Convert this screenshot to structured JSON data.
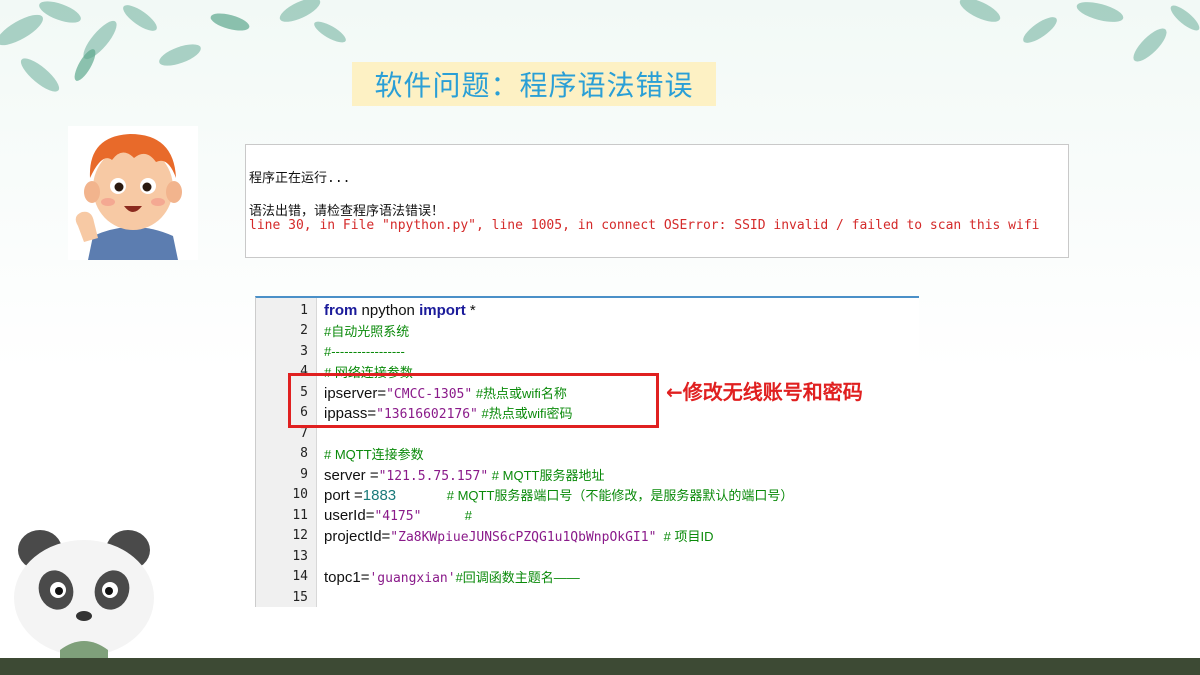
{
  "title": "软件问题：程序语法错误",
  "console": {
    "running": "程序正在运行...",
    "error": "语法出错，请检查程序语法错误！",
    "detail": "line 30, in File \"npython.py\", line 1005, in connect OSError: SSID invalid / failed to scan this wifi"
  },
  "callout": "←修改无线账号和密码",
  "code_lines": [
    {
      "n": "1",
      "parts": [
        [
          "kw",
          "from"
        ],
        [
          "plain",
          " npython "
        ],
        [
          "kw",
          "import"
        ],
        [
          "plain",
          " *"
        ]
      ]
    },
    {
      "n": "2",
      "parts": [
        [
          "cmt",
          "#自动光照系统"
        ]
      ]
    },
    {
      "n": "3",
      "parts": [
        [
          "cmt",
          "#-----------------"
        ]
      ]
    },
    {
      "n": "4",
      "parts": [
        [
          "cmt",
          "# 网络连接参数"
        ]
      ]
    },
    {
      "n": "5",
      "parts": [
        [
          "plain",
          "ipserver="
        ],
        [
          "str",
          "\"CMCC-1305\""
        ],
        [
          "cmt",
          " #热点或wifi名称"
        ]
      ]
    },
    {
      "n": "6",
      "parts": [
        [
          "plain",
          "ippass="
        ],
        [
          "str",
          "\"13616602176\""
        ],
        [
          "cmt",
          " #热点或wifi密码"
        ]
      ]
    },
    {
      "n": "7",
      "parts": []
    },
    {
      "n": "8",
      "parts": [
        [
          "cmt",
          "# MQTT连接参数"
        ]
      ]
    },
    {
      "n": "9",
      "parts": [
        [
          "plain",
          "server ="
        ],
        [
          "str",
          "\"121.5.75.157\""
        ],
        [
          "cmt",
          " # MQTT服务器地址"
        ]
      ]
    },
    {
      "n": "10",
      "parts": [
        [
          "plain",
          "port ="
        ],
        [
          "num",
          "1883"
        ],
        [
          "cmt",
          "              # MQTT服务器端口号（不能修改，是服务器默认的端口号）"
        ]
      ]
    },
    {
      "n": "11",
      "parts": [
        [
          "plain",
          "userId="
        ],
        [
          "str",
          "\"4175\""
        ],
        [
          "cmt",
          "            #"
        ]
      ]
    },
    {
      "n": "12",
      "parts": [
        [
          "plain",
          "projectId="
        ],
        [
          "str",
          "\"Za8KWpiueJUNS6cPZQG1u1QbWnpOkGI1\""
        ],
        [
          "cmt",
          "  # 项目ID"
        ]
      ]
    },
    {
      "n": "13",
      "parts": []
    },
    {
      "n": "14",
      "parts": [
        [
          "plain",
          "topc1="
        ],
        [
          "str",
          "'guangxian'"
        ],
        [
          "cmt",
          "#回调函数主题名——"
        ]
      ]
    },
    {
      "n": "15",
      "parts": []
    }
  ]
}
